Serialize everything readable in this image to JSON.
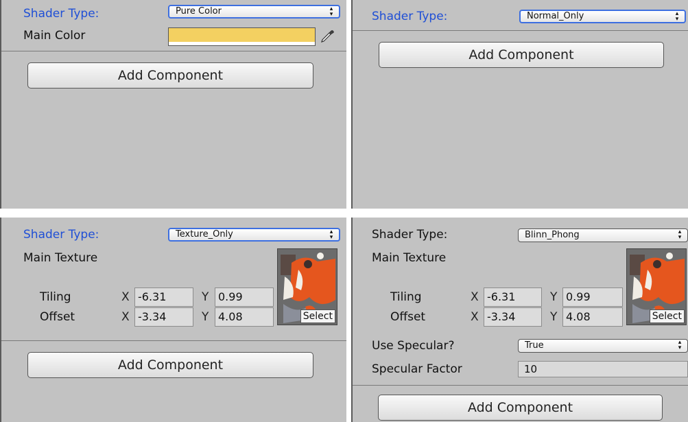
{
  "panel1": {
    "shader_label": "Shader Type:",
    "shader_value": "Pure Color",
    "main_color_label": "Main Color",
    "main_color_value": "#f3d061",
    "add_component": "Add Component"
  },
  "panel2": {
    "shader_label": "Shader Type:",
    "shader_value": "Normal_Only",
    "add_component": "Add Component"
  },
  "panel3": {
    "shader_label": "Shader Type:",
    "shader_value": "Texture_Only",
    "main_texture_label": "Main Texture",
    "tiling_label": "Tiling",
    "offset_label": "Offset",
    "tiling_x": "-6.31",
    "tiling_y": "0.99",
    "offset_x": "-3.34",
    "offset_y": "4.08",
    "axis_x": "X",
    "axis_y": "Y",
    "select": "Select",
    "add_component": "Add Component"
  },
  "panel4": {
    "shader_label": "Shader Type:",
    "shader_value": "Blinn_Phong",
    "main_texture_label": "Main Texture",
    "tiling_label": "Tiling",
    "offset_label": "Offset",
    "tiling_x": "-6.31",
    "tiling_y": "0.99",
    "offset_x": "-3.34",
    "offset_y": "4.08",
    "axis_x": "X",
    "axis_y": "Y",
    "select": "Select",
    "use_specular_label": "Use Specular?",
    "use_specular_value": "True",
    "specular_factor_label": "Specular Factor",
    "specular_factor_value": "10",
    "add_component": "Add Component"
  },
  "colors": {
    "focus_blue": "#1f4fd6",
    "panel_bg": "#c2c2c2",
    "main_color": "#f3d061"
  },
  "icons": {
    "color_picker": "eyedropper-icon",
    "dropdown": "up-down-arrows-icon"
  }
}
